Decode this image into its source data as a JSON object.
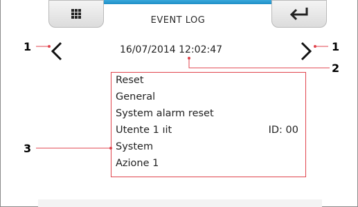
{
  "header": {
    "title": "EVENT LOG"
  },
  "buttons": {
    "menu_icon": "grid-icon",
    "enter_icon": "enter-return-icon",
    "prev_icon": "chevron-left-icon",
    "next_icon": "chevron-right-icon"
  },
  "event": {
    "datetime": "16/07/2014 12:02:47",
    "lines": [
      "Reset",
      "General",
      "System alarm reset",
      "Utente 1 ıit",
      "System",
      "Azione 1"
    ],
    "id_label": "ID: 00"
  },
  "callouts": {
    "left_arrow": "1",
    "right_arrow": "1",
    "datetime": "2",
    "event_box": "3"
  },
  "colors": {
    "accent_strip": "#1f8fc6",
    "callout_line": "#e0434c",
    "button_bg": "#e6e6e6"
  }
}
